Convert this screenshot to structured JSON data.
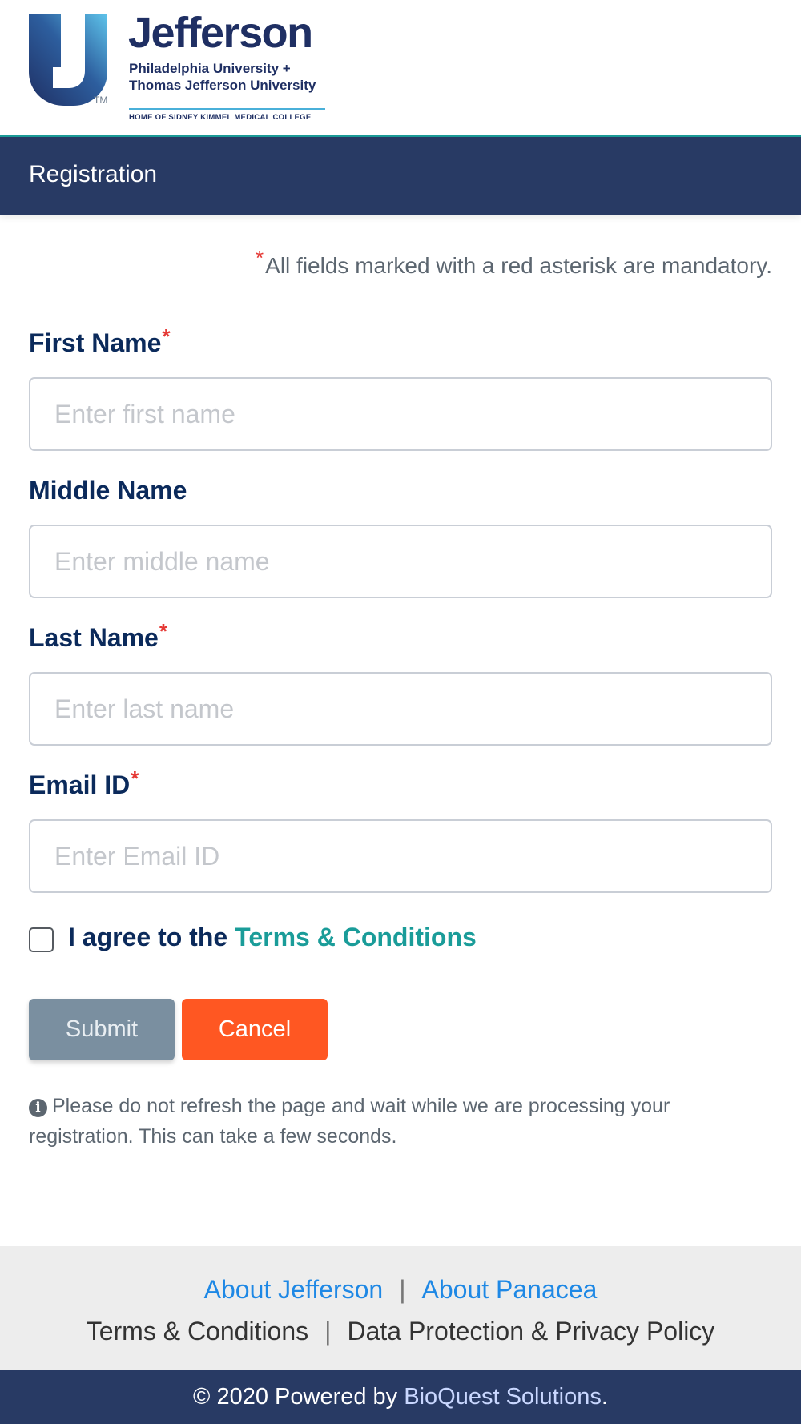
{
  "logo": {
    "wordmark": "Jefferson",
    "line1": "Philadelphia University +",
    "line2": "Thomas Jefferson University",
    "line3": "HOME OF SIDNEY KIMMEL MEDICAL COLLEGE",
    "tm": "TM"
  },
  "page": {
    "title": "Registration"
  },
  "form": {
    "required_marker": "*",
    "mandatory_note": "All fields marked with a red asterisk are mandatory.",
    "fields": [
      {
        "label": "First Name",
        "required": true,
        "placeholder": "Enter first name",
        "value": ""
      },
      {
        "label": "Middle Name",
        "required": false,
        "placeholder": "Enter middle name",
        "value": ""
      },
      {
        "label": "Last Name",
        "required": true,
        "placeholder": "Enter last name",
        "value": ""
      },
      {
        "label": "Email ID",
        "required": true,
        "placeholder": "Enter Email ID",
        "value": ""
      }
    ],
    "agree_text": "I agree to the",
    "terms_link": "Terms & Conditions",
    "agree_checked": false,
    "submit_label": "Submit",
    "cancel_label": "Cancel",
    "info_note": "Please do not refresh the page and wait while we are processing your registration. This can take a few seconds."
  },
  "footer": {
    "about_jefferson": "About Jefferson",
    "about_panacea": "About Panacea",
    "terms": "Terms & Conditions",
    "privacy": "Data Protection & Privacy Policy",
    "separator": "|",
    "copyright_prefix": "© 2020 Powered by",
    "company": "BioQuest Solutions",
    "copyright_suffix": "."
  },
  "colors": {
    "brand_navy": "#283a64",
    "teal_accent": "#1c9c98",
    "cancel_orange": "#ff5722",
    "submit_gray": "#7a8fa0",
    "required_red": "#e53935",
    "link_blue": "#1e88e5"
  }
}
